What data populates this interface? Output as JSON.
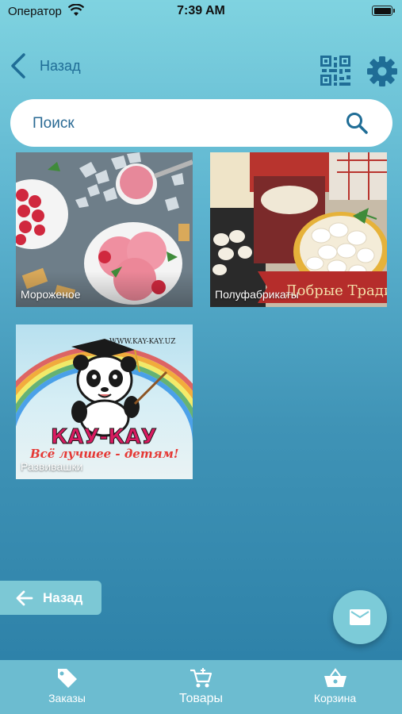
{
  "status_bar": {
    "carrier": "Оператор",
    "time": "7:39 AM"
  },
  "nav": {
    "back_label": "Назад",
    "icons": [
      "chevron-left-icon",
      "qr-code-icon",
      "gear-icon"
    ]
  },
  "search": {
    "placeholder": "Поиск",
    "icon": "search-icon"
  },
  "categories": [
    {
      "label": "Мороженое",
      "image": "ice-cream-photo"
    },
    {
      "label": "Полуфабрикаты",
      "image": "dumplings-photo"
    },
    {
      "label": "Развивашки",
      "image": "kay-kay-logo"
    }
  ],
  "logo_text": {
    "url": "WWW.KAY-KAY.UZ",
    "brand": "КАУ-КАУ",
    "slogan": "Всё лучшее - детям!"
  },
  "back_button": {
    "label": "Назад"
  },
  "fab": {
    "icon": "mail-icon"
  },
  "tabbar": {
    "items": [
      {
        "label": "Заказы",
        "icon": "tag-icon"
      },
      {
        "label": "Товары",
        "icon": "cart-icon",
        "active": true
      },
      {
        "label": "Корзина",
        "icon": "basket-icon"
      }
    ]
  },
  "colors": {
    "accent": "#1f6d96",
    "tabbar": "#6cbcd0",
    "fab": "#7ccbd8"
  }
}
